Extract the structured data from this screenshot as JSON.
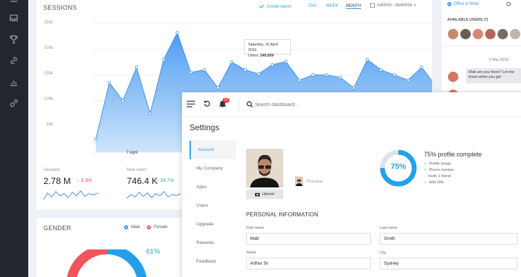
{
  "sidebar": {
    "icons": [
      "menu-icon",
      "inbox-icon",
      "trophy-icon",
      "link-icon",
      "chart-icon",
      "settings-icon"
    ]
  },
  "sessions": {
    "title": "SESSIONS",
    "create_report": "Create report",
    "ranges": [
      "DAY",
      "WEEK",
      "MONTH"
    ],
    "active_range": "MONTH",
    "date_range": "1/4/2016 - 30/4/2016",
    "tooltip": {
      "date": "Saturday, 16 April 2016",
      "label": "Users:",
      "value": "245,659"
    },
    "x_tick": "7 April"
  },
  "chart_data": {
    "type": "area",
    "yticks": [
      "250k",
      "200k",
      "150k",
      "100k",
      "50k"
    ],
    "ylim": [
      0,
      250000
    ],
    "x_label": "7 April",
    "values": [
      25000,
      135000,
      100000,
      165000,
      75000,
      180000,
      232000,
      155000,
      160000,
      125000,
      175000,
      160000,
      152000,
      170000,
      176000,
      140000,
      150000,
      150000,
      145000,
      125000,
      180000,
      160000,
      150000,
      140000,
      165000,
      130000,
      120000,
      130000
    ],
    "color": "#4e9cf2"
  },
  "stats": [
    {
      "label": "Sessions",
      "value": "2.78 M",
      "delta": "5.3%",
      "dir": "down"
    },
    {
      "label": "New users",
      "value": "746.4 K",
      "delta": "34.7%",
      "dir": "up"
    }
  ],
  "gender": {
    "title": "GENDER",
    "legend": [
      "Male",
      "Female"
    ],
    "percent": "61%",
    "colors": {
      "male": "#23a0ec",
      "female": "#f0545d"
    }
  },
  "chat": {
    "filter": "Office & Work",
    "available_label": "AVAILABLE USERS (7)",
    "date": "3 May 2016",
    "message": "Matt are you there? Let me know when you get"
  },
  "settings": {
    "search_placeholder": "Search dashboard...",
    "notif_count": "12",
    "title": "Settings",
    "menu": [
      "Account",
      "My Company",
      "Apps",
      "Users",
      "Upgrade",
      "Rewards",
      "Feedback"
    ],
    "active_menu": "Account",
    "upload_label": "Upload",
    "preview_label": "Preview",
    "profile_percent": "75%",
    "profile_title": "75% profile complete",
    "checklist": [
      {
        "label": "Profile image",
        "done": true
      },
      {
        "label": "Phone number",
        "done": true
      },
      {
        "label": "Invite 1 friend",
        "done": false
      },
      {
        "label": "Add URL",
        "done": true
      }
    ],
    "section_title": "PERSONAL INFORMATION",
    "fields": {
      "first_name": {
        "label": "First name",
        "value": "Matt"
      },
      "last_name": {
        "label": "Last name",
        "value": "Smith"
      },
      "street": {
        "label": "Street",
        "value": "Arthur St"
      },
      "city": {
        "label": "City",
        "value": "Sydney"
      }
    }
  }
}
